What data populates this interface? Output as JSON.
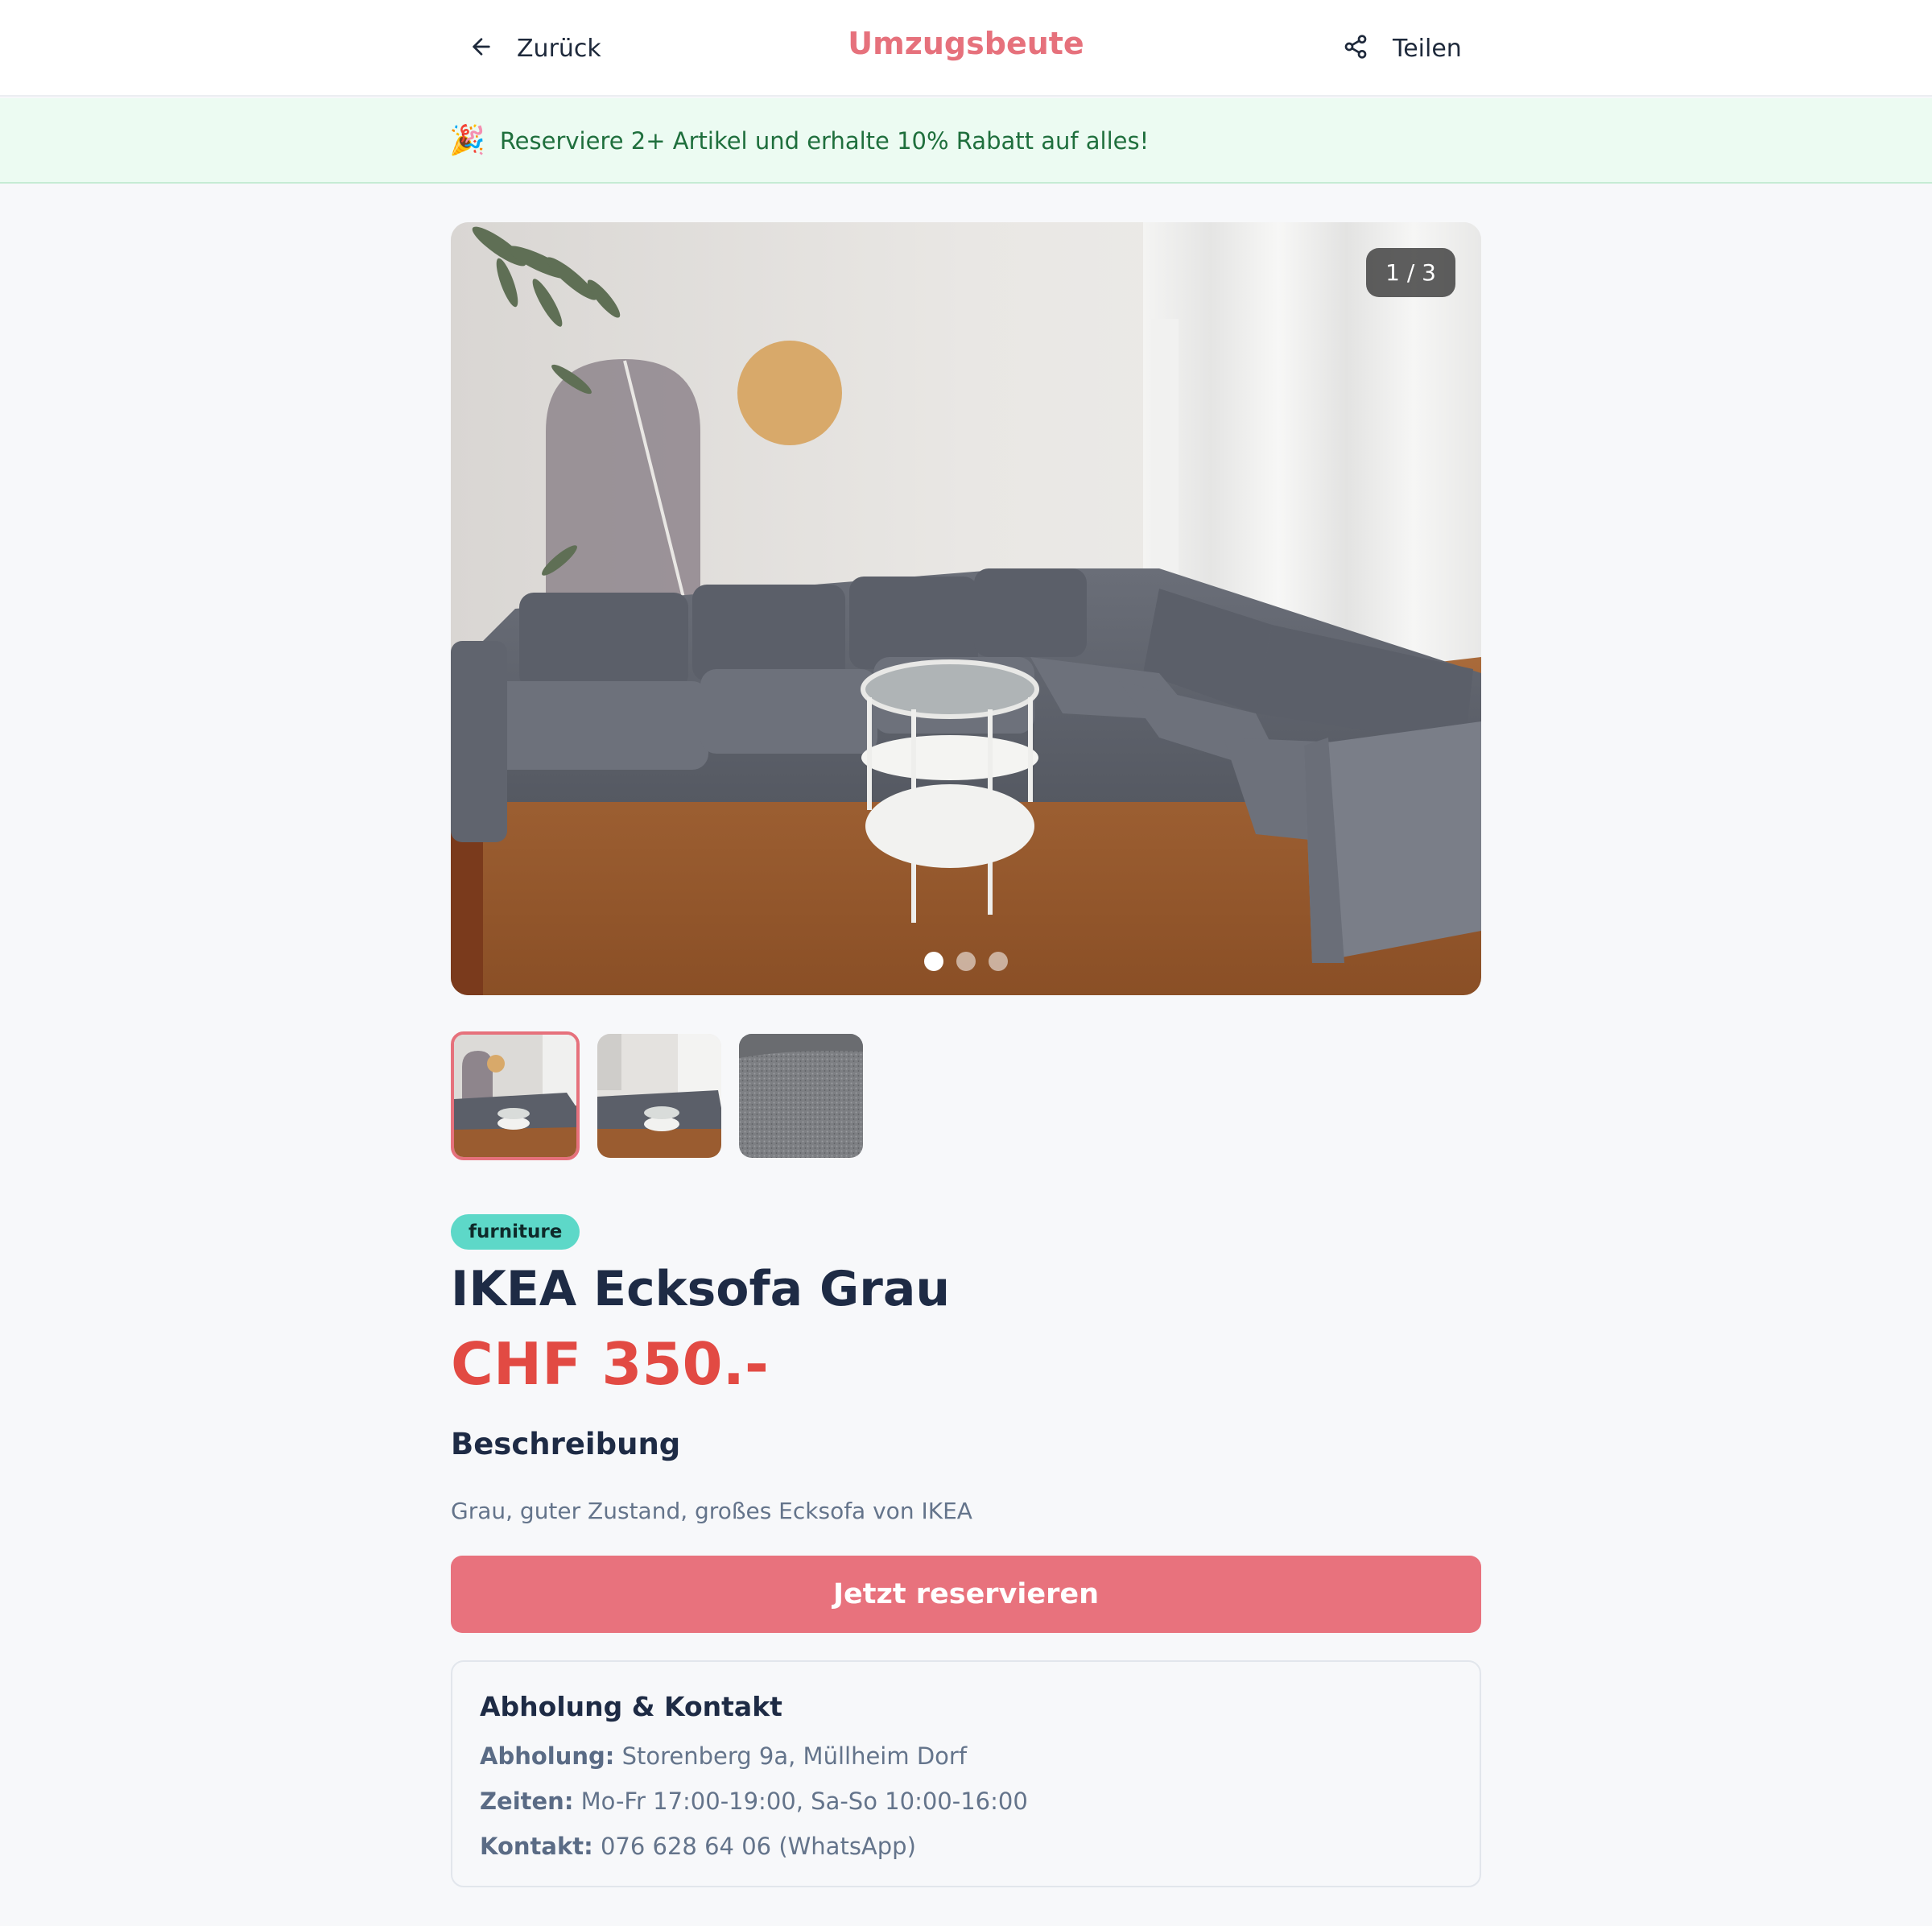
{
  "header": {
    "back_label": "Zurück",
    "brand": "Umzugsbeute",
    "share_label": "Teilen",
    "brand_color": "#e6717c"
  },
  "promo": {
    "icon": "party-popper-icon",
    "text": "Reserviere 2+ Artikel und erhalte 10% Rabatt auf alles!"
  },
  "gallery": {
    "counter": "1 / 3",
    "current_index": 1,
    "total": 3
  },
  "product": {
    "category": "furniture",
    "title": "IKEA Ecksofa Grau",
    "price": "CHF 350.-",
    "description_heading": "Beschreibung",
    "description": "Grau, guter Zustand, großes Ecksofa von IKEA",
    "cta_label": "Jetzt reservieren",
    "price_color": "#e24a43",
    "cta_color": "#e8727d"
  },
  "pickup": {
    "heading": "Abholung & Kontakt",
    "address_label": "Abholung:",
    "address": "Storenberg 9a, Müllheim Dorf",
    "hours_label": "Zeiten:",
    "hours": "Mo-Fr 17:00-19:00, Sa-So 10:00-16:00",
    "contact_label": "Kontakt:",
    "contact": "076 628 64 06 (WhatsApp)"
  }
}
